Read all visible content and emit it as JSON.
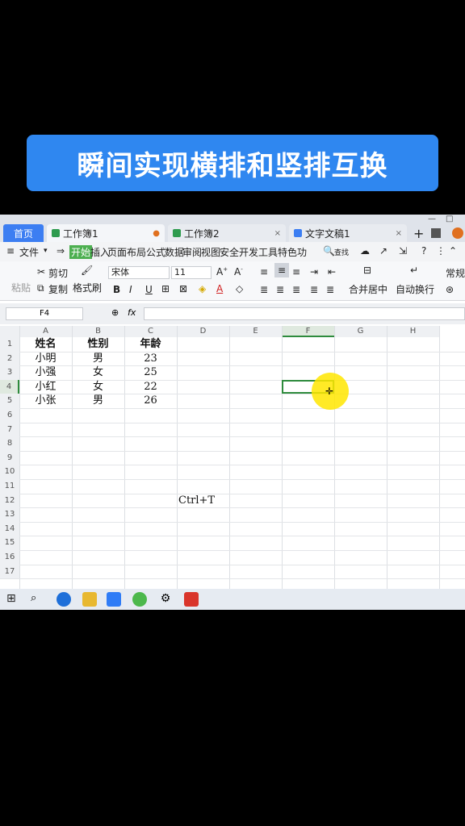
{
  "banner": "瞬间实现横排和竖排互换",
  "tabs": {
    "home": "首页",
    "workbook1": "工作簿1",
    "workbook2": "工作簿2",
    "textdoc": "文字文稿1"
  },
  "menu": [
    "文件",
    "开始",
    "插入",
    "页面布局",
    "公式",
    "数据",
    "审阅",
    "视图",
    "安全",
    "开发工具",
    "特色功"
  ],
  "menu_search": "查找",
  "ribbon": {
    "cut": "剪切",
    "paste": "粘贴",
    "copy": "复制",
    "format_painter": "格式刷",
    "font": "宋体",
    "size": "11",
    "merge": "合并居中",
    "wrap": "自动换行",
    "normal": "常规"
  },
  "name_box": "F4",
  "fx": "fx",
  "columns": [
    "A",
    "B",
    "C",
    "D",
    "E",
    "F",
    "G",
    "H"
  ],
  "rows": [
    "1",
    "2",
    "3",
    "4",
    "5",
    "6",
    "7",
    "8",
    "9",
    "10",
    "11",
    "12",
    "13",
    "14",
    "15",
    "16",
    "17"
  ],
  "table": [
    [
      "姓名",
      "性别",
      "年龄"
    ],
    [
      "小明",
      "男",
      "23"
    ],
    [
      "小强",
      "女",
      "25"
    ],
    [
      "小红",
      "女",
      "22"
    ],
    [
      "小张",
      "男",
      "26"
    ]
  ],
  "annotation": "Ctrl+T",
  "colors": {
    "banner": "#2f87f0",
    "home_tab": "#3c7ef2",
    "selection": "#2e8b3d",
    "cursor": "#ffe600"
  }
}
